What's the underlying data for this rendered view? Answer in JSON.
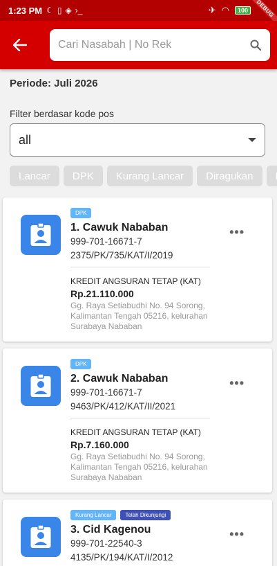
{
  "status_bar": {
    "time": "1:23 PM",
    "battery": "100",
    "debug": "DEBUG"
  },
  "header": {
    "search_placeholder": "Cari Nasabah | No Rek"
  },
  "periode": "Periode: Juli 2026",
  "filter": {
    "label": "Filter berdasar kode pos",
    "selected": "all"
  },
  "chips": [
    "Lancar",
    "DPK",
    "Kurang Lancar",
    "Diragukan",
    "Macet"
  ],
  "cards": [
    {
      "badges": [
        {
          "label": "DPK",
          "style": "light"
        }
      ],
      "name": "1. Cawuk Nababan",
      "account": "999-701-16671-7",
      "contract": "2375/PK/735/KAT/I/2019",
      "type": "KREDIT ANGSURAN TETAP (KAT)",
      "amount": "Rp.21.110.000",
      "address": "Gg. Raya Setiabudhi No. 94 Sorong, Kalimantan Tengah 05216, kelurahan Surabaya Nababan"
    },
    {
      "badges": [
        {
          "label": "DPK",
          "style": "light"
        }
      ],
      "name": "2. Cawuk Nababan",
      "account": "999-701-16671-7",
      "contract": "9463/PK/412/KAT/II/2021",
      "type": "KREDIT ANGSURAN TETAP (KAT)",
      "amount": "Rp.7.160.000",
      "address": "Gg. Raya Setiabudhi No. 94 Sorong, Kalimantan Tengah 05216, kelurahan Surabaya Nababan"
    },
    {
      "badges": [
        {
          "label": "Kurang Lancar",
          "style": "light"
        },
        {
          "label": "Telah Dikunjungi",
          "style": "dark"
        }
      ],
      "name": "3. Cid Kagenou",
      "account": "999-701-22540-3",
      "contract": "4135/PK/194/KAT/I/2012"
    }
  ],
  "colors": {
    "primary": "#d40000",
    "avatar": "#3a86e8",
    "badge_light": "#64b5f6",
    "badge_dark": "#3f51b5"
  },
  "icons": [
    "back-arrow-icon",
    "search-icon",
    "dropdown-caret-icon",
    "contact-badge-icon",
    "more-options-icon"
  ]
}
